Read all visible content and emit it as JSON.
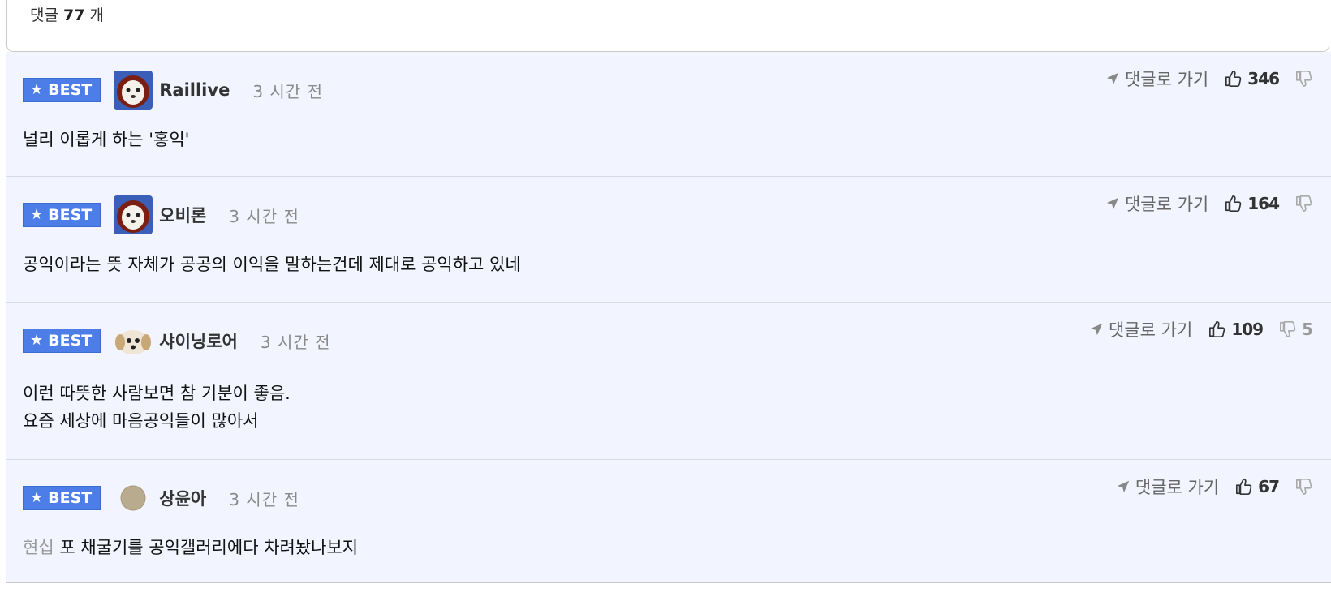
{
  "header": {
    "label": "댓글",
    "count": "77",
    "unit": "개"
  },
  "comments": [
    {
      "badge": "BEST",
      "nickname": "Raillive",
      "time": "3 시간 전",
      "goto_label": "댓글로 가기",
      "upvotes": "346",
      "downvotes": "",
      "text_lines": [
        "널리 이롭게 하는 '홍익'"
      ],
      "prefix": ""
    },
    {
      "badge": "BEST",
      "nickname": "오비론",
      "time": "3 시간 전",
      "goto_label": "댓글로 가기",
      "upvotes": "164",
      "downvotes": "",
      "text_lines": [
        "공익이라는 뜻 자체가 공공의 이익을 말하는건데 제대로 공익하고 있네"
      ],
      "prefix": ""
    },
    {
      "badge": "BEST",
      "nickname": "샤이닝로어",
      "time": "3 시간 전",
      "goto_label": "댓글로 가기",
      "upvotes": "109",
      "downvotes": "5",
      "text_lines": [
        "이런 따뜻한 사람보면 참 기분이 좋음.",
        "요즘 세상에 마음공익들이 많아서"
      ],
      "prefix": ""
    },
    {
      "badge": "BEST",
      "nickname": "상윤아",
      "time": "3 시간 전",
      "goto_label": "댓글로 가기",
      "upvotes": "67",
      "downvotes": "",
      "text_lines": [
        "포 채굴기를 공익갤러리에다 차려놨나보지"
      ],
      "prefix": "현십"
    }
  ],
  "colors": {
    "best_badge": "#4d7ee8",
    "comment_bg": "#f2f5ff"
  },
  "icons": [
    "star-icon",
    "send-arrow-icon",
    "thumbs-up-icon",
    "thumbs-down-icon"
  ]
}
